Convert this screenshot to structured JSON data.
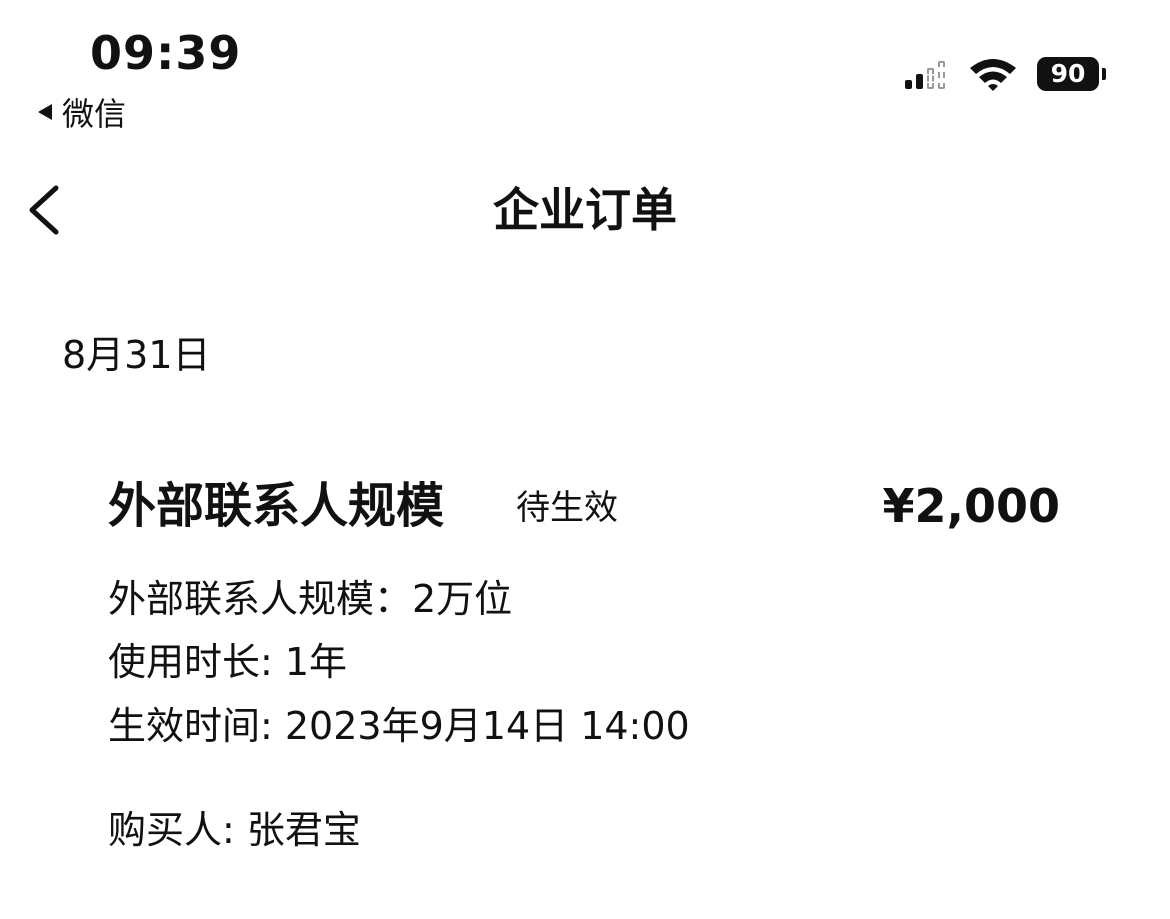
{
  "status_bar": {
    "time": "09:39",
    "back_app": "微信",
    "battery": "90"
  },
  "nav": {
    "title": "企业订单"
  },
  "section": {
    "date": "8月31日"
  },
  "order": {
    "name": "外部联系人规模",
    "status": "待生效",
    "price": "¥2,000",
    "details": [
      "外部联系人规模：2万位",
      "使用时长: 1年",
      "生效时间: 2023年9月14日 14:00"
    ],
    "buyer": "购买人: 张君宝"
  },
  "icons": {
    "back": "chevron-left-icon",
    "signal": "signal-icon",
    "wifi": "wifi-icon",
    "battery": "battery-icon"
  }
}
